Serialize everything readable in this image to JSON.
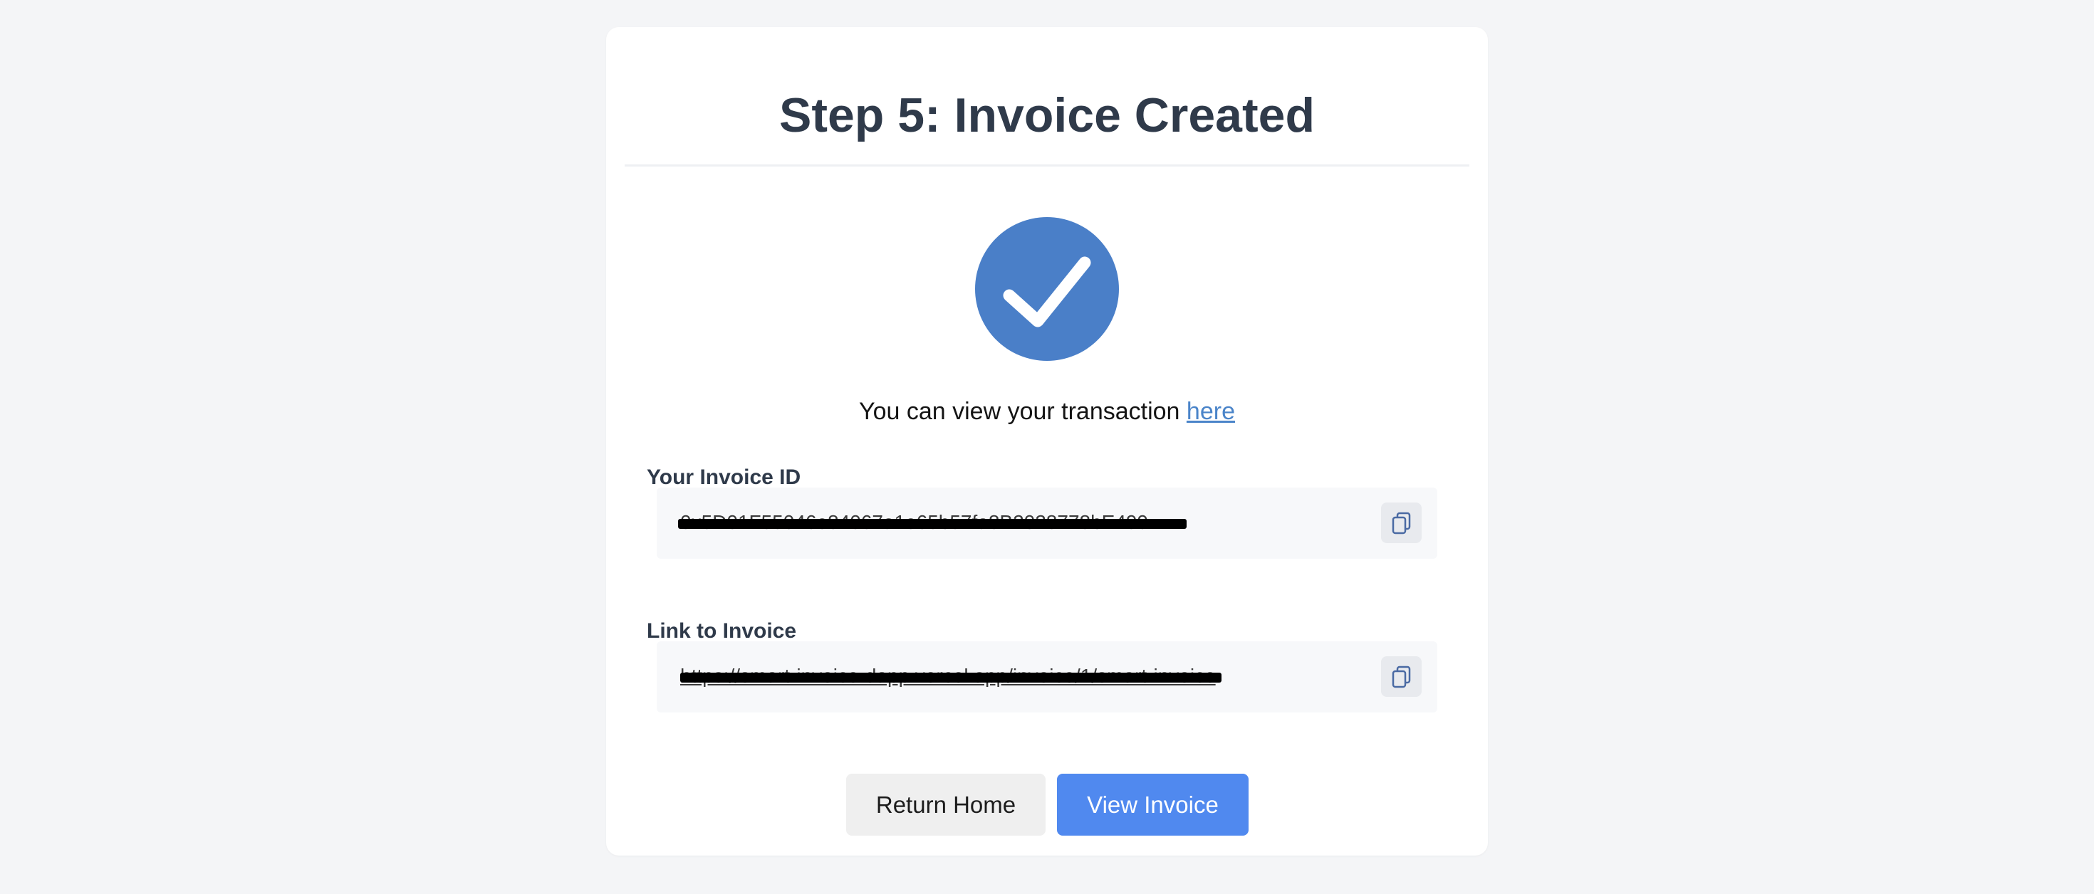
{
  "page": {
    "title": "Step 5: Invoice Created"
  },
  "status": {
    "message_prefix": "You can view your transaction ",
    "link_text": "here"
  },
  "invoice_id": {
    "label": "Your Invoice ID",
    "value": "0x5D01F55046e84067a1e65b57fa8B2028778bE499"
  },
  "invoice_link": {
    "label": "Link to Invoice",
    "value": "https://smart-invoice-dapp.vercel.app/invoice/1/smart-invoice"
  },
  "buttons": {
    "return_home": "Return Home",
    "view_invoice": "View Invoice"
  },
  "colors": {
    "accent": "#4a84c9",
    "primary_button": "#5089ef",
    "title": "#2f3a4a",
    "background": "#f4f5f7"
  },
  "icons": {
    "status": "checkmark-circle-icon",
    "copy": "copy-icon"
  }
}
